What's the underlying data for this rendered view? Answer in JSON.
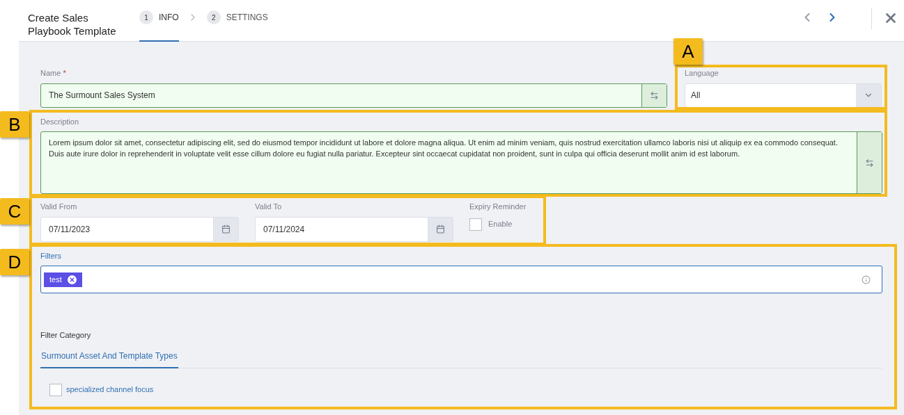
{
  "header": {
    "title": "Create Sales Playbook Template",
    "steps": [
      {
        "number": "1",
        "label": "INFO",
        "selected": true
      },
      {
        "number": "2",
        "label": "SETTINGS",
        "selected": false
      }
    ],
    "prev": {
      "disabled": true
    },
    "next": {
      "disabled": false
    }
  },
  "form": {
    "name": {
      "label": "Name",
      "required_mark": "*",
      "value": "The Surmount Sales System"
    },
    "language": {
      "label": "Language",
      "value": "All"
    },
    "description": {
      "label": "Description",
      "value": "Lorem ipsum dolor sit amet, consectetur adipiscing elit, sed do eiusmod tempor incididunt ut labore et dolore magna aliqua. Ut enim ad minim veniam, quis nostrud exercitation ullamco laboris nisi ut aliquip ex ea commodo consequat.  Duis aute irure dolor in reprehenderit in voluptate velit esse cillum dolore eu fugiat nulla pariatur. Excepteur sint occaecat cupidatat non proident, sunt in culpa qui officia deserunt mollit anim id est laborum."
    },
    "valid_from": {
      "label": "Valid From",
      "value": "07/11/2023"
    },
    "valid_to": {
      "label": "Valid To",
      "value": "07/11/2024"
    },
    "expiry_reminder": {
      "label": "Expiry Reminder",
      "option": "Enable",
      "checked": false
    },
    "filters": {
      "label": "Filters",
      "tags": [
        {
          "label": "test"
        }
      ]
    },
    "filter_category": {
      "label": "Filter Category",
      "tabs": [
        {
          "label": "Surmount Asset And Template Types",
          "selected": true
        }
      ],
      "options": [
        {
          "label": "specialized channel focus",
          "checked": false
        }
      ]
    }
  },
  "annotations": [
    {
      "label": "A"
    },
    {
      "label": "B"
    },
    {
      "label": "C"
    },
    {
      "label": "D"
    }
  ]
}
